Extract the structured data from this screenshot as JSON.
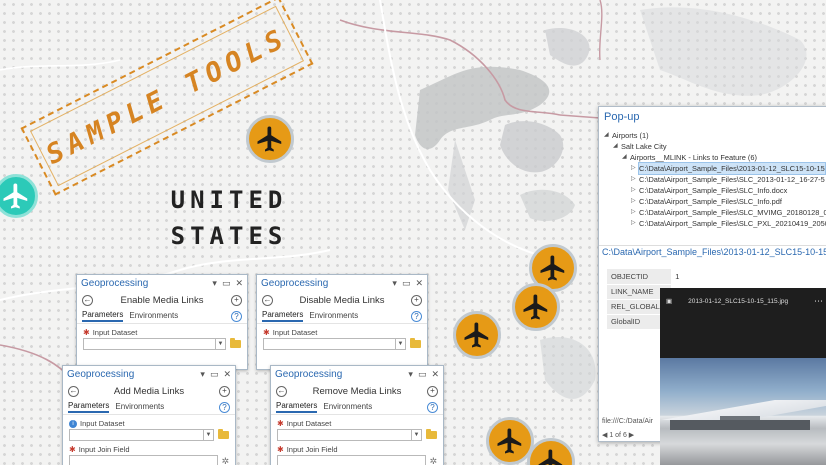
{
  "stamp": {
    "text": "SAMPLE TOOLS"
  },
  "map": {
    "country_line1": "UNITED",
    "country_line2": "STATES"
  },
  "geoprocessing": [
    {
      "title": "Geoprocessing",
      "tool": "Enable Media Links",
      "tabs": [
        "Parameters",
        "Environments"
      ],
      "params": [
        {
          "label": "Input Dataset",
          "value": ""
        }
      ]
    },
    {
      "title": "Geoprocessing",
      "tool": "Disable Media Links",
      "tabs": [
        "Parameters",
        "Environments"
      ],
      "params": [
        {
          "label": "Input Dataset",
          "value": ""
        }
      ]
    },
    {
      "title": "Geoprocessing",
      "tool": "Add Media Links",
      "tabs": [
        "Parameters",
        "Environments"
      ],
      "params": [
        {
          "label": "Input Dataset",
          "value": ""
        },
        {
          "label": "Input Join Field",
          "value": ""
        }
      ]
    },
    {
      "title": "Geoprocessing",
      "tool": "Remove Media Links",
      "tabs": [
        "Parameters",
        "Environments"
      ],
      "params": [
        {
          "label": "Input Dataset",
          "value": ""
        },
        {
          "label": "Input Join Field",
          "value": ""
        }
      ]
    }
  ],
  "popup": {
    "title": "Pop-up",
    "tree": [
      {
        "label": "Airports (1)",
        "indent": 0,
        "arrow": "◢"
      },
      {
        "label": "Salt Lake City",
        "indent": 1,
        "arrow": "◢"
      },
      {
        "label": "Airports__MLINK - Links to Feature (6)",
        "indent": 2,
        "arrow": "◢"
      },
      {
        "label": "C:\\Data\\Airport_Sample_Files\\2013-01-12_SLC15-10-15",
        "indent": 3,
        "arrow": "▷",
        "selected": true
      },
      {
        "label": "C:\\Data\\Airport_Sample_Files\\SLC_2013-01-12_16-27-5",
        "indent": 3,
        "arrow": "▷"
      },
      {
        "label": "C:\\Data\\Airport_Sample_Files\\SLC_Info.docx",
        "indent": 3,
        "arrow": "▷"
      },
      {
        "label": "C:\\Data\\Airport_Sample_Files\\SLC_Info.pdf",
        "indent": 3,
        "arrow": "▷"
      },
      {
        "label": "C:\\Data\\Airport_Sample_Files\\SLC_MVIMG_20180128_0",
        "indent": 3,
        "arrow": "▷"
      },
      {
        "label": "C:\\Data\\Airport_Sample_Files\\SLC_PXL_20210419_2050",
        "indent": 3,
        "arrow": "▷"
      }
    ],
    "selected_path": "C:\\Data\\Airport_Sample_Files\\2013-01-12_SLC15-10-15_",
    "fields": [
      {
        "k": "OBJECTID",
        "v": "1"
      },
      {
        "k": "LINK_NAME",
        "v": ""
      },
      {
        "k": "REL_GLOBALID",
        "v": ""
      },
      {
        "k": "GlobalID",
        "v": ""
      }
    ],
    "footer_link": "file:///C:/Data/Air",
    "pager": "1 of 6"
  },
  "viewer": {
    "filename": "2013-01-12_SLC15-10-15_115.jpg",
    "more": "⋯"
  }
}
